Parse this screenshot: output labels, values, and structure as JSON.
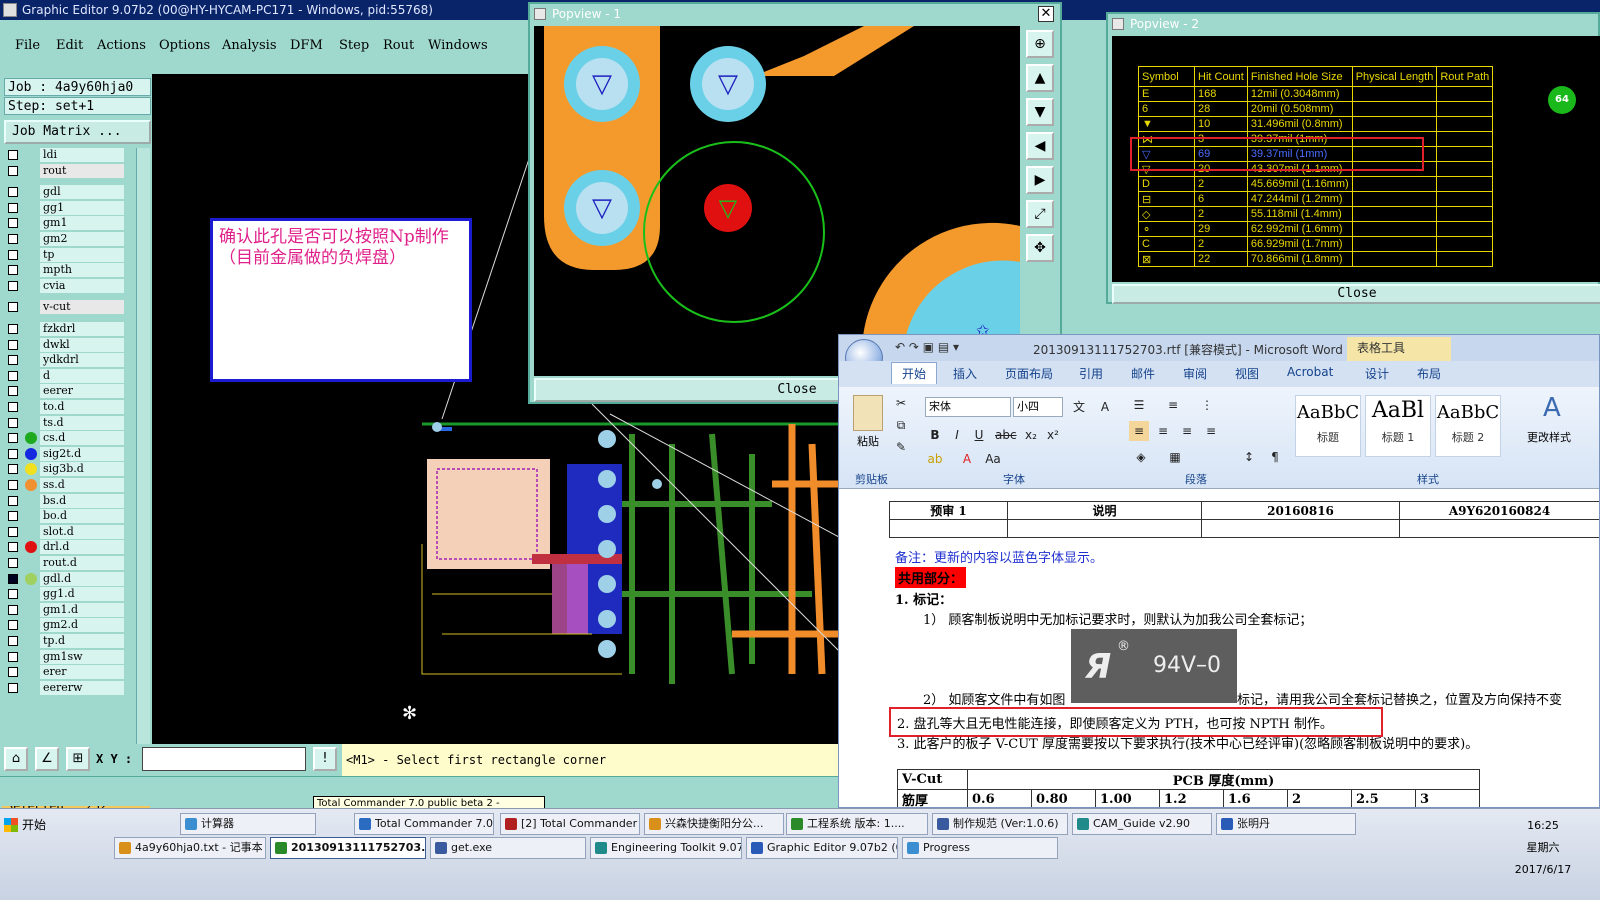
{
  "app": {
    "title": "Graphic Editor 9.07b2 (00@HY-HYCAM-PC171 - Windows, pid:55768)",
    "menu": [
      "File",
      "Edit",
      "Actions",
      "Options",
      "Analysis",
      "DFM",
      "Step",
      "Rout",
      "Windows"
    ]
  },
  "job": {
    "job_label": "Job : 4a9y60hja0",
    "step_label": "Step: set+1",
    "job_matrix": "Job Matrix ..."
  },
  "layers": [
    {
      "name": "ldi",
      "color": ""
    },
    {
      "name": "rout",
      "color": "",
      "highlight": true
    },
    {
      "name": "gdl",
      "color": ""
    },
    {
      "name": "gg1",
      "color": ""
    },
    {
      "name": "gm1",
      "color": ""
    },
    {
      "name": "gm2",
      "color": ""
    },
    {
      "name": "tp",
      "color": ""
    },
    {
      "name": "mpth",
      "color": ""
    },
    {
      "name": "cvia",
      "color": ""
    },
    {
      "name": "v-cut",
      "color": "",
      "highlight": true
    },
    {
      "name": "fzkdrl",
      "color": ""
    },
    {
      "name": "dwkl",
      "color": ""
    },
    {
      "name": "ydkdrl",
      "color": ""
    },
    {
      "name": "d",
      "color": ""
    },
    {
      "name": "eerer",
      "color": ""
    },
    {
      "name": "to.d",
      "color": ""
    },
    {
      "name": "ts.d",
      "color": ""
    },
    {
      "name": "cs.d",
      "color": "#1eaa1e"
    },
    {
      "name": "sig2t.d",
      "color": "#1428e0"
    },
    {
      "name": "sig3b.d",
      "color": "#f0e020"
    },
    {
      "name": "ss.d",
      "color": "#f09030"
    },
    {
      "name": "bs.d",
      "color": ""
    },
    {
      "name": "bo.d",
      "color": ""
    },
    {
      "name": "slot.d",
      "color": ""
    },
    {
      "name": "drl.d",
      "color": "#e01010"
    },
    {
      "name": "rout.d",
      "color": ""
    },
    {
      "name": "gdl.d",
      "color": "#a0d060",
      "selected": true
    },
    {
      "name": "gg1.d",
      "color": ""
    },
    {
      "name": "gm1.d",
      "color": ""
    },
    {
      "name": "gm2.d",
      "color": ""
    },
    {
      "name": "tp.d",
      "color": ""
    },
    {
      "name": "gm1sw",
      "color": ""
    },
    {
      "name": "erer",
      "color": ""
    },
    {
      "name": "eererw",
      "color": ""
    }
  ],
  "status": {
    "selected": "Selected : 252",
    "xy_label": "X Y :",
    "xy_value": "",
    "prompt": "<M1> - Select first rectangle corner"
  },
  "note": {
    "text": "确认此孔是否可以按照Np制作（目前金属做的负焊盘）"
  },
  "popview1": {
    "title": "Popview - 1",
    "close_label": "Close"
  },
  "popview2": {
    "title": "Popview - 2",
    "close_label": "Close",
    "columns": [
      "Symbol",
      "Hit Count",
      "Finished Hole Size",
      "Physical Length",
      "Rout Path"
    ],
    "rows": [
      {
        "symbol": "E",
        "count": "168",
        "size": "12mil (0.3048mm)",
        "blue": false
      },
      {
        "symbol": "6",
        "count": "28",
        "size": "20mil (0.508mm)",
        "blue": false
      },
      {
        "symbol": "▼",
        "count": "10",
        "size": "31.496mil (0.8mm)",
        "blue": false
      },
      {
        "symbol": "⋈",
        "count": "3",
        "size": "39.37mil (1mm)",
        "blue": false
      },
      {
        "symbol": "▽",
        "count": "69",
        "size": "39.37mil (1mm)",
        "blue": true
      },
      {
        "symbol": "▽",
        "count": "20",
        "size": "43.307mil (1.1mm)",
        "blue": false
      },
      {
        "symbol": "D",
        "count": "2",
        "size": "45.669mil (1.16mm)",
        "blue": false
      },
      {
        "symbol": "⊟",
        "count": "6",
        "size": "47.244mil (1.2mm)",
        "blue": false
      },
      {
        "symbol": "◇",
        "count": "2",
        "size": "55.118mil (1.4mm)",
        "blue": false
      },
      {
        "symbol": "⚬",
        "count": "29",
        "size": "62.992mil (1.6mm)",
        "blue": false
      },
      {
        "symbol": "C",
        "count": "2",
        "size": "66.929mil (1.7mm)",
        "blue": false
      },
      {
        "symbol": "⊠",
        "count": "22",
        "size": "70.866mil (1.8mm)",
        "blue": false
      }
    ],
    "badge": "64"
  },
  "word": {
    "caption": "20130913111752703.rtf [兼容模式] - Microsoft Word",
    "context_tab": "表格工具",
    "tabs": [
      "开始",
      "插入",
      "页面布局",
      "引用",
      "邮件",
      "审阅",
      "视图",
      "Acrobat",
      "设计",
      "布局"
    ],
    "font_name": "宋体",
    "font_size": "小四",
    "groups": [
      "剪贴板",
      "字体",
      "段落",
      "样式"
    ],
    "paste_label": "粘贴",
    "change_styles": "更改样式",
    "styles": [
      {
        "sample": "AaBbC",
        "name": "标题"
      },
      {
        "sample": "AaBl",
        "name": "标题 1"
      },
      {
        "sample": "AaBbC",
        "name": "标题 2"
      }
    ],
    "doc": {
      "table_row": [
        "预审 1",
        "说明",
        "20160816",
        "A9Y620160824"
      ],
      "remark": "备注：更新的内容以蓝色字体显示。",
      "shared": "共用部分：",
      "item1": "1.   标记：",
      "item1_1": "1） 顾客制板说明中无加标记要求时，则默认为加我公司全套标记；",
      "ul_text": "94V–0",
      "item1_2a": "2） 如顾客文件中有如图",
      "item1_2b": "标记，请用我公司全套标记替换之，位置及方向保持不变",
      "item2": "2.   盘孔等大且无电性能连接，即使顾客定义为 PTH，也可按 NPTH 制作。",
      "item3": "3.   此客户的板子 V-CUT 厚度需要按以下要求执行(技术中心已经评审)(忽略顾客制板说明中的要求)。",
      "vcut_header": [
        "V-Cut",
        "PCB 厚度(mm)"
      ],
      "vcut_row": [
        "筋厚",
        "0.6",
        "0.80",
        "1.00",
        "1.2",
        "1.6",
        "2",
        "2.5",
        "3"
      ]
    }
  },
  "taskbar": {
    "start": "开始",
    "tooltip": "Total Commander 7.0 public beta 2 - HelpInHand",
    "row1": [
      "计算器",
      "Total Commander 7.0...",
      "[2] Total Commander ...",
      "兴森快捷衡阳分公...",
      "工程系统  版本: 1....",
      "制作规范 (Ver:1.0.6)",
      "CAM_Guide v2.90",
      "张明丹"
    ],
    "row2": [
      "4a9y60hja0.txt - 记事本",
      "20130913111752703....",
      "get.exe",
      "Engineering Toolkit 9.07...",
      "Graphic Editor 9.07b2 (0...",
      "Progress"
    ],
    "clock_time": "16:25",
    "clock_day": "星期六",
    "clock_date": "2017/6/17"
  }
}
